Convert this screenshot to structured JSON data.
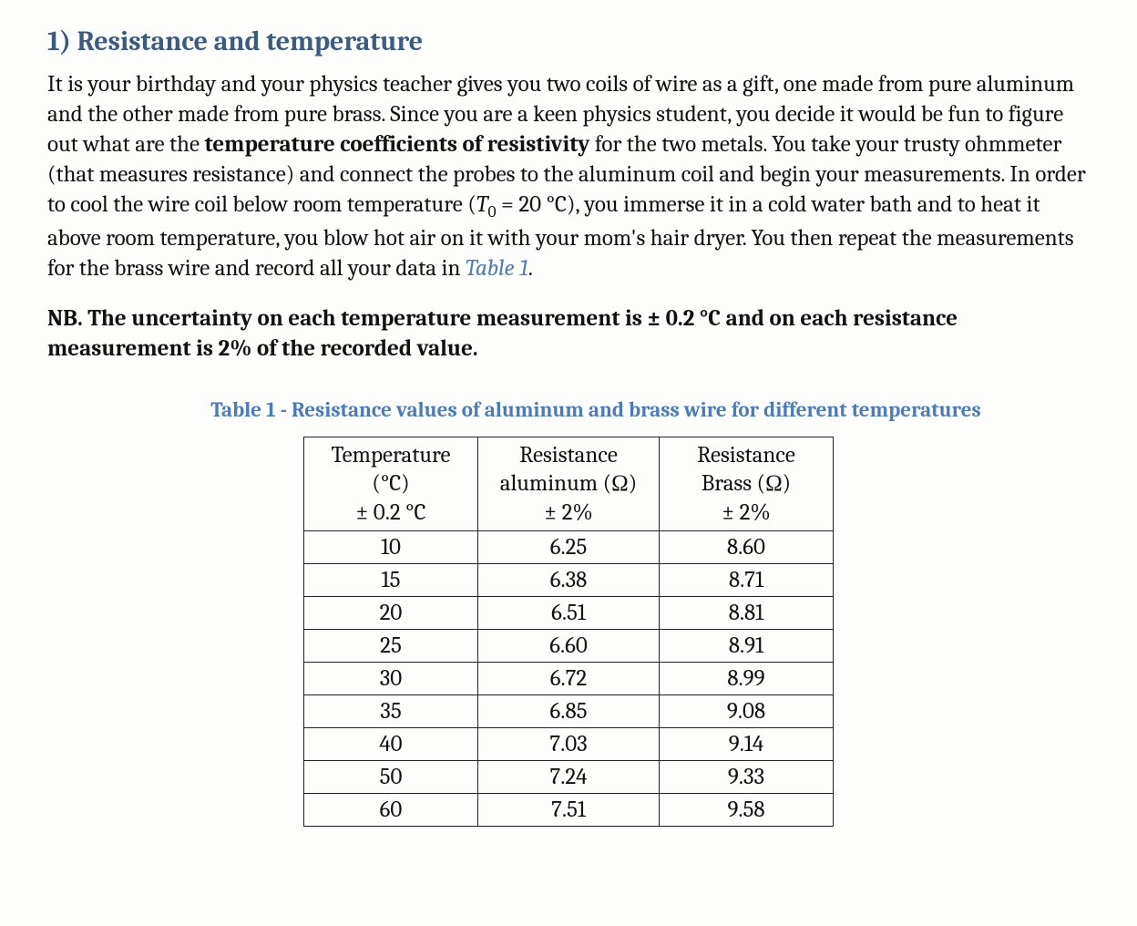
{
  "heading": "1) Resistance and temperature",
  "para1a": "It is your birthday and your physics teacher gives you two coils of wire as a gift, one made from pure aluminum and the other made from pure brass. Since you are a keen physics student, you decide it would be fun to figure out what are the ",
  "para1b_bold": "temperature coefficients of resistivity",
  "para1c": " for the two metals. You take your trusty ohmmeter (that measures resistance) and connect the probes to the aluminum coil and begin your measurements. In order to cool the wire coil below room temperature (",
  "para1d_T": "T",
  "para1d_sub": "0",
  "para1e": " = 20 °C), you immerse it in a cold water bath and to heat it above room temperature, you blow hot air on it with your mom's hair dryer. You then repeat the measurements for the brass wire and record all your data in ",
  "para1f_link": "Table 1",
  "para1g": ".",
  "nb": "NB. The uncertainty on each temperature measurement is ± 0.2 °C and on each resistance measurement is 2% of the recorded value.",
  "caption": "Table 1 - Resistance values of aluminum and brass wire for different temperatures",
  "chart_data": {
    "type": "table",
    "columns": [
      {
        "l1": "Temperature",
        "l2": "(°C)",
        "l3": "± 0.2 °C"
      },
      {
        "l1": "Resistance",
        "l2": "aluminum (Ω)",
        "l3": "± 2%"
      },
      {
        "l1": "Resistance",
        "l2": "Brass (Ω)",
        "l3": "± 2%"
      }
    ],
    "rows": [
      {
        "t": "10",
        "a": "6.25",
        "b": "8.60"
      },
      {
        "t": "15",
        "a": "6.38",
        "b": "8.71"
      },
      {
        "t": "20",
        "a": "6.51",
        "b": "8.81"
      },
      {
        "t": "25",
        "a": "6.60",
        "b": "8.91"
      },
      {
        "t": "30",
        "a": "6.72",
        "b": "8.99"
      },
      {
        "t": "35",
        "a": "6.85",
        "b": "9.08"
      },
      {
        "t": "40",
        "a": "7.03",
        "b": "9.14"
      },
      {
        "t": "50",
        "a": "7.24",
        "b": "9.33"
      },
      {
        "t": "60",
        "a": "7.51",
        "b": "9.58"
      }
    ]
  }
}
